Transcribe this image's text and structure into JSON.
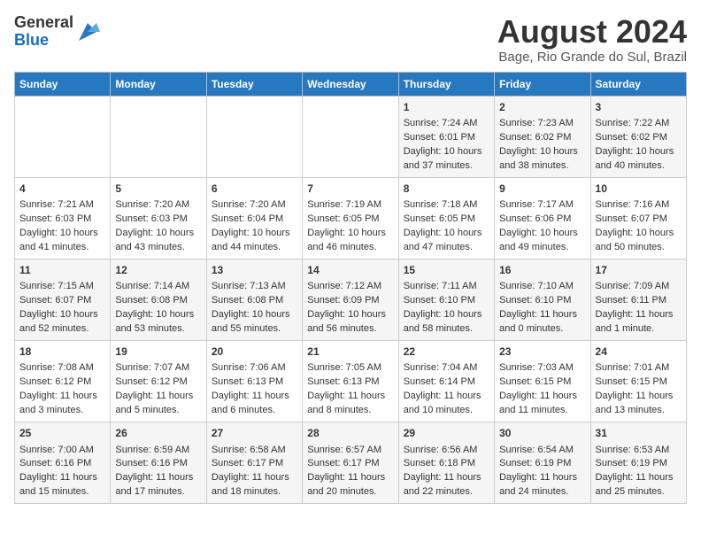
{
  "logo": {
    "general": "General",
    "blue": "Blue"
  },
  "title": "August 2024",
  "subtitle": "Bage, Rio Grande do Sul, Brazil",
  "headers": [
    "Sunday",
    "Monday",
    "Tuesday",
    "Wednesday",
    "Thursday",
    "Friday",
    "Saturday"
  ],
  "weeks": [
    [
      {
        "day": "",
        "sunrise": "",
        "sunset": "",
        "daylight": ""
      },
      {
        "day": "",
        "sunrise": "",
        "sunset": "",
        "daylight": ""
      },
      {
        "day": "",
        "sunrise": "",
        "sunset": "",
        "daylight": ""
      },
      {
        "day": "",
        "sunrise": "",
        "sunset": "",
        "daylight": ""
      },
      {
        "day": "1",
        "sunrise": "Sunrise: 7:24 AM",
        "sunset": "Sunset: 6:01 PM",
        "daylight": "Daylight: 10 hours and 37 minutes."
      },
      {
        "day": "2",
        "sunrise": "Sunrise: 7:23 AM",
        "sunset": "Sunset: 6:02 PM",
        "daylight": "Daylight: 10 hours and 38 minutes."
      },
      {
        "day": "3",
        "sunrise": "Sunrise: 7:22 AM",
        "sunset": "Sunset: 6:02 PM",
        "daylight": "Daylight: 10 hours and 40 minutes."
      }
    ],
    [
      {
        "day": "4",
        "sunrise": "Sunrise: 7:21 AM",
        "sunset": "Sunset: 6:03 PM",
        "daylight": "Daylight: 10 hours and 41 minutes."
      },
      {
        "day": "5",
        "sunrise": "Sunrise: 7:20 AM",
        "sunset": "Sunset: 6:03 PM",
        "daylight": "Daylight: 10 hours and 43 minutes."
      },
      {
        "day": "6",
        "sunrise": "Sunrise: 7:20 AM",
        "sunset": "Sunset: 6:04 PM",
        "daylight": "Daylight: 10 hours and 44 minutes."
      },
      {
        "day": "7",
        "sunrise": "Sunrise: 7:19 AM",
        "sunset": "Sunset: 6:05 PM",
        "daylight": "Daylight: 10 hours and 46 minutes."
      },
      {
        "day": "8",
        "sunrise": "Sunrise: 7:18 AM",
        "sunset": "Sunset: 6:05 PM",
        "daylight": "Daylight: 10 hours and 47 minutes."
      },
      {
        "day": "9",
        "sunrise": "Sunrise: 7:17 AM",
        "sunset": "Sunset: 6:06 PM",
        "daylight": "Daylight: 10 hours and 49 minutes."
      },
      {
        "day": "10",
        "sunrise": "Sunrise: 7:16 AM",
        "sunset": "Sunset: 6:07 PM",
        "daylight": "Daylight: 10 hours and 50 minutes."
      }
    ],
    [
      {
        "day": "11",
        "sunrise": "Sunrise: 7:15 AM",
        "sunset": "Sunset: 6:07 PM",
        "daylight": "Daylight: 10 hours and 52 minutes."
      },
      {
        "day": "12",
        "sunrise": "Sunrise: 7:14 AM",
        "sunset": "Sunset: 6:08 PM",
        "daylight": "Daylight: 10 hours and 53 minutes."
      },
      {
        "day": "13",
        "sunrise": "Sunrise: 7:13 AM",
        "sunset": "Sunset: 6:08 PM",
        "daylight": "Daylight: 10 hours and 55 minutes."
      },
      {
        "day": "14",
        "sunrise": "Sunrise: 7:12 AM",
        "sunset": "Sunset: 6:09 PM",
        "daylight": "Daylight: 10 hours and 56 minutes."
      },
      {
        "day": "15",
        "sunrise": "Sunrise: 7:11 AM",
        "sunset": "Sunset: 6:10 PM",
        "daylight": "Daylight: 10 hours and 58 minutes."
      },
      {
        "day": "16",
        "sunrise": "Sunrise: 7:10 AM",
        "sunset": "Sunset: 6:10 PM",
        "daylight": "Daylight: 11 hours and 0 minutes."
      },
      {
        "day": "17",
        "sunrise": "Sunrise: 7:09 AM",
        "sunset": "Sunset: 6:11 PM",
        "daylight": "Daylight: 11 hours and 1 minute."
      }
    ],
    [
      {
        "day": "18",
        "sunrise": "Sunrise: 7:08 AM",
        "sunset": "Sunset: 6:12 PM",
        "daylight": "Daylight: 11 hours and 3 minutes."
      },
      {
        "day": "19",
        "sunrise": "Sunrise: 7:07 AM",
        "sunset": "Sunset: 6:12 PM",
        "daylight": "Daylight: 11 hours and 5 minutes."
      },
      {
        "day": "20",
        "sunrise": "Sunrise: 7:06 AM",
        "sunset": "Sunset: 6:13 PM",
        "daylight": "Daylight: 11 hours and 6 minutes."
      },
      {
        "day": "21",
        "sunrise": "Sunrise: 7:05 AM",
        "sunset": "Sunset: 6:13 PM",
        "daylight": "Daylight: 11 hours and 8 minutes."
      },
      {
        "day": "22",
        "sunrise": "Sunrise: 7:04 AM",
        "sunset": "Sunset: 6:14 PM",
        "daylight": "Daylight: 11 hours and 10 minutes."
      },
      {
        "day": "23",
        "sunrise": "Sunrise: 7:03 AM",
        "sunset": "Sunset: 6:15 PM",
        "daylight": "Daylight: 11 hours and 11 minutes."
      },
      {
        "day": "24",
        "sunrise": "Sunrise: 7:01 AM",
        "sunset": "Sunset: 6:15 PM",
        "daylight": "Daylight: 11 hours and 13 minutes."
      }
    ],
    [
      {
        "day": "25",
        "sunrise": "Sunrise: 7:00 AM",
        "sunset": "Sunset: 6:16 PM",
        "daylight": "Daylight: 11 hours and 15 minutes."
      },
      {
        "day": "26",
        "sunrise": "Sunrise: 6:59 AM",
        "sunset": "Sunset: 6:16 PM",
        "daylight": "Daylight: 11 hours and 17 minutes."
      },
      {
        "day": "27",
        "sunrise": "Sunrise: 6:58 AM",
        "sunset": "Sunset: 6:17 PM",
        "daylight": "Daylight: 11 hours and 18 minutes."
      },
      {
        "day": "28",
        "sunrise": "Sunrise: 6:57 AM",
        "sunset": "Sunset: 6:17 PM",
        "daylight": "Daylight: 11 hours and 20 minutes."
      },
      {
        "day": "29",
        "sunrise": "Sunrise: 6:56 AM",
        "sunset": "Sunset: 6:18 PM",
        "daylight": "Daylight: 11 hours and 22 minutes."
      },
      {
        "day": "30",
        "sunrise": "Sunrise: 6:54 AM",
        "sunset": "Sunset: 6:19 PM",
        "daylight": "Daylight: 11 hours and 24 minutes."
      },
      {
        "day": "31",
        "sunrise": "Sunrise: 6:53 AM",
        "sunset": "Sunset: 6:19 PM",
        "daylight": "Daylight: 11 hours and 25 minutes."
      }
    ]
  ]
}
